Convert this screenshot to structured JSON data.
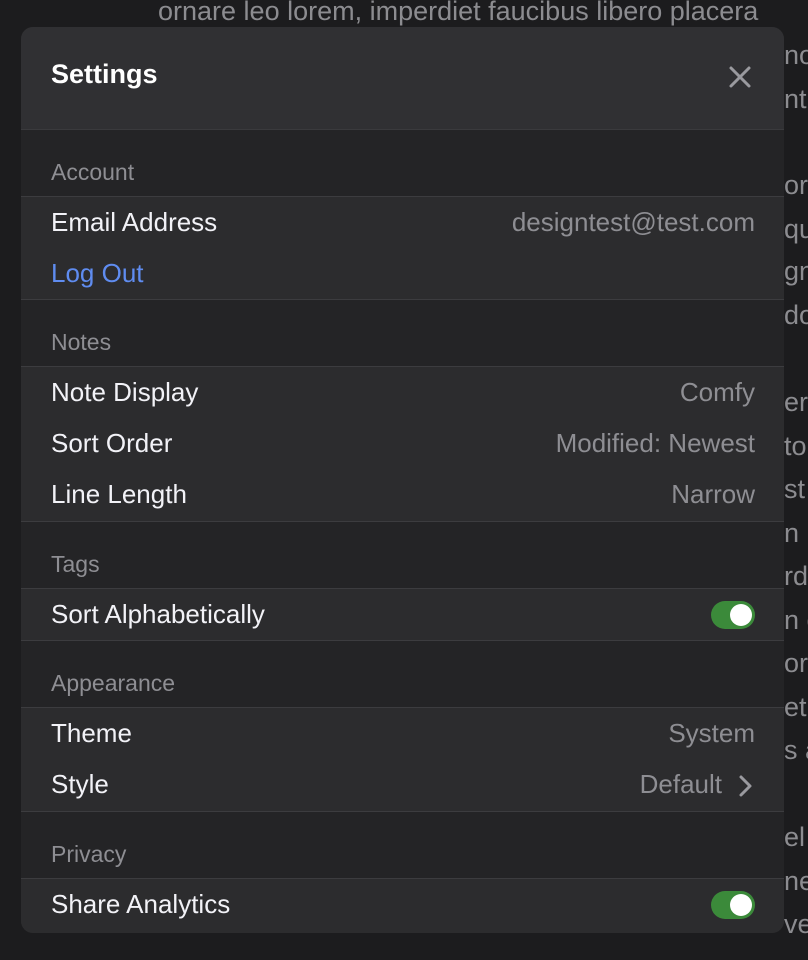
{
  "background_text": [
    "ornare leo lorem, imperdiet faucibus libero placera",
    "no",
    "ntu",
    "or",
    "qua",
    "gn",
    "do",
    "er",
    "to",
    "st",
    "n",
    "rd",
    "n c",
    "or",
    "etu",
    "s a",
    "el",
    "ne",
    "ve"
  ],
  "settings": {
    "title": "Settings",
    "close_icon": "close-icon",
    "sections": {
      "account": {
        "label": "Account",
        "email_label": "Email Address",
        "email_value": "designtest@test.com",
        "logout_label": "Log Out"
      },
      "notes": {
        "label": "Notes",
        "note_display_label": "Note Display",
        "note_display_value": "Comfy",
        "sort_order_label": "Sort Order",
        "sort_order_value": "Modified: Newest",
        "line_length_label": "Line Length",
        "line_length_value": "Narrow"
      },
      "tags": {
        "label": "Tags",
        "sort_alpha_label": "Sort Alphabetically",
        "sort_alpha_on": true
      },
      "appearance": {
        "label": "Appearance",
        "theme_label": "Theme",
        "theme_value": "System",
        "style_label": "Style",
        "style_value": "Default"
      },
      "privacy": {
        "label": "Privacy",
        "share_analytics_label": "Share Analytics",
        "share_analytics_on": true
      }
    }
  },
  "colors": {
    "link": "#5f8cf0",
    "toggle_on": "#3b8a3a",
    "modal_bg": "#2c2c2e",
    "section_bg": "#242426"
  }
}
